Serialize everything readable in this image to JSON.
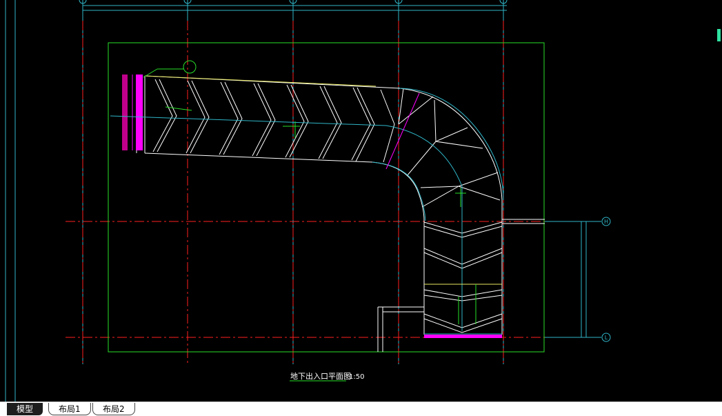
{
  "drawing": {
    "title": "地下出入口平面图",
    "scale": "1:50",
    "axis_labels": {
      "h": "H",
      "l": "L"
    },
    "colors": {
      "background": "#000000",
      "axis": "#ff2020",
      "grid_cyan": "#2fb6c8",
      "outline_green": "#28e028",
      "wall_white": "#ffffff",
      "magenta": "#ff00ff",
      "yellow": "#e8e860"
    }
  },
  "tabs": [
    {
      "label": "模型",
      "active": true
    },
    {
      "label": "布局1",
      "active": false
    },
    {
      "label": "布局2",
      "active": false
    }
  ]
}
